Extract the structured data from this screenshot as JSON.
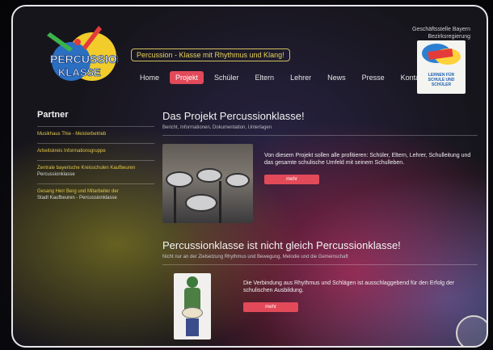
{
  "header": {
    "logo_line1": "PERCUSSION",
    "logo_line2": "KLASSE",
    "tagline": "Percussion - Klasse mit Rhythmus und Klang!",
    "office_line1": "Geschäftsstelle Bayern",
    "office_line2": "Bezirksregierung",
    "badge_text": "LERNEN FÜR SCHULE UND SCHÜLER",
    "nav": [
      {
        "label": "Home"
      },
      {
        "label": "Projekt"
      },
      {
        "label": "Schüler"
      },
      {
        "label": "Eltern"
      },
      {
        "label": "Lehrer"
      },
      {
        "label": "News"
      },
      {
        "label": "Presse"
      },
      {
        "label": "Kontakt"
      }
    ],
    "active_nav": "Projekt"
  },
  "sidebar": {
    "title": "Partner",
    "items": [
      {
        "a": "Musikhaus Thie - Meisterbetrieb",
        "b": ""
      },
      {
        "a": "Arbeitskreis Informationsgruppe",
        "b": ""
      },
      {
        "a": "Zentrale bayerische Kreisschulen Kaufbeuren",
        "b": "Percussionklasse"
      },
      {
        "a": "Gesang Herr Berg und Mitarbeiter der",
        "b": "Stadt Kaufbeuren - Percussionklasse"
      }
    ]
  },
  "main": {
    "section1": {
      "title": "Das Projekt Percussionklasse!",
      "subtitle": "Bericht, Informationen, Dokumentation, Unterlagen",
      "text": "Von diesem Projekt sollen alle profitieren: Schüler, Eltern, Lehrer, Schulleitung und das gesamte schulische Umfeld mit seinem Schulleben.",
      "button": "mehr"
    },
    "section2": {
      "title": "Percussionklasse ist nicht gleich Percussionklasse!",
      "subtitle": "Nicht nur an der Zielsetzung Rhythmus und Bewegung, Melodie und die Gemeinschaft",
      "text": "Die Verbindung aus Rhythmus und Schlägen ist ausschlaggebend für den Erfolg der schulischen Ausbildung.",
      "button": "mehr"
    }
  },
  "colors": {
    "accent": "#e24a59",
    "highlight": "#e3c84c",
    "background": "#17151c"
  }
}
